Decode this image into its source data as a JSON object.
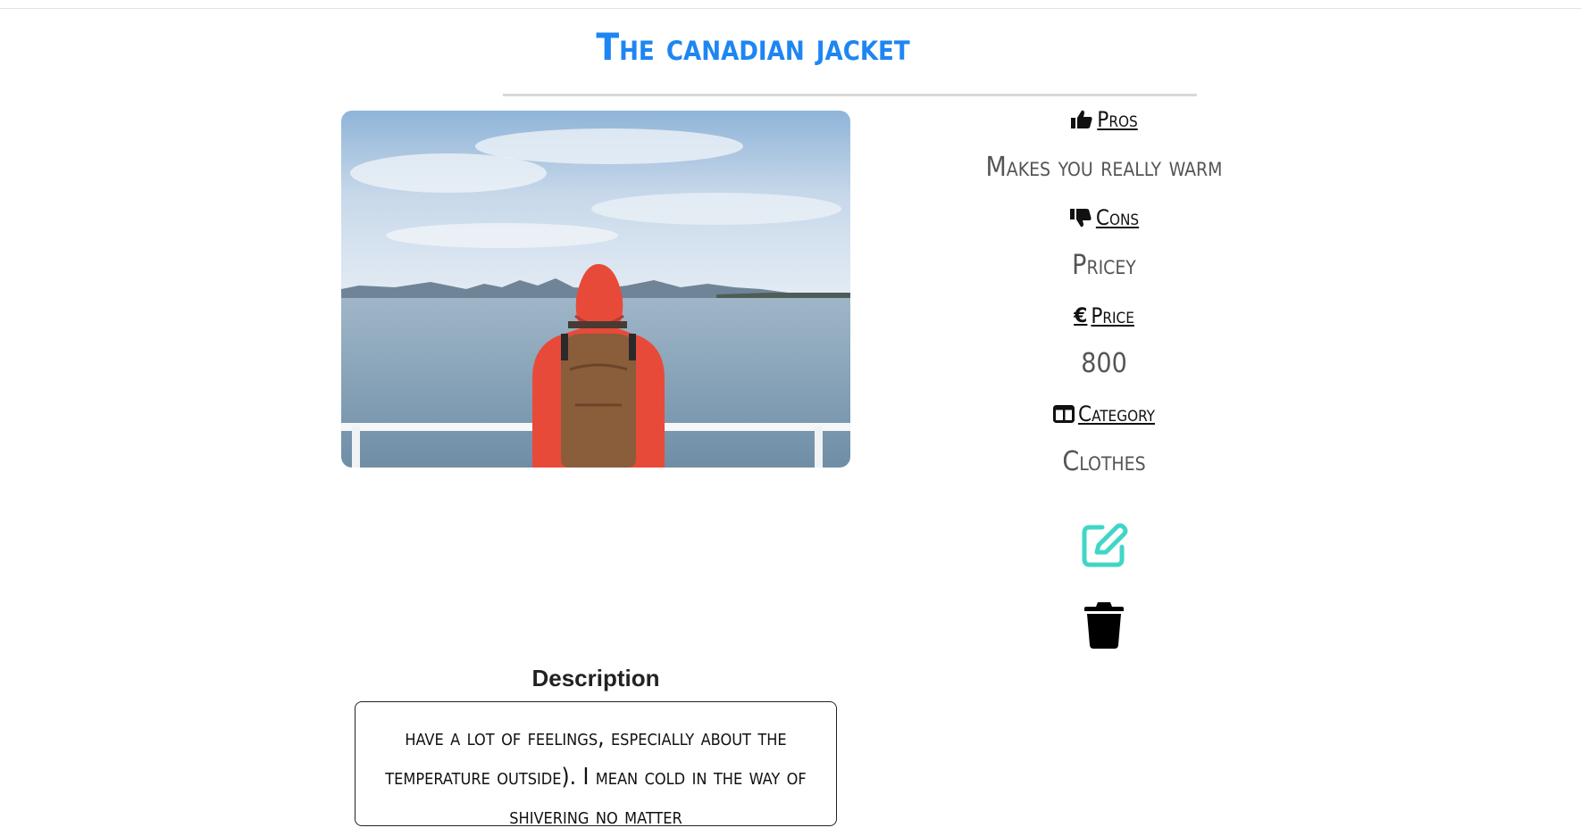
{
  "product": {
    "title": "The canadian jacket"
  },
  "photo": {
    "alt_subject": "person-in-red-jacket-icon"
  },
  "info": {
    "pros_label": "Pros",
    "pros_value": "Makes you really warm",
    "cons_label": "Cons",
    "cons_value": "Pricey",
    "price_label": "Price",
    "price_value": "800",
    "category_label": "Category",
    "category_value": "Clothes"
  },
  "description": {
    "label": "Description",
    "text": "have a lot of feelings, especially about the temperature outside). I mean cold in the way of shivering no matter"
  },
  "colors": {
    "title": "#1e86f2",
    "edit_icon": "#40d6c6",
    "delete_icon": "#000000"
  },
  "icons": {
    "pros": "thumbs-up-icon",
    "cons": "thumbs-down-icon",
    "price": "euro-icon",
    "category": "table-columns-icon",
    "edit": "edit-icon",
    "delete": "trash-icon"
  }
}
